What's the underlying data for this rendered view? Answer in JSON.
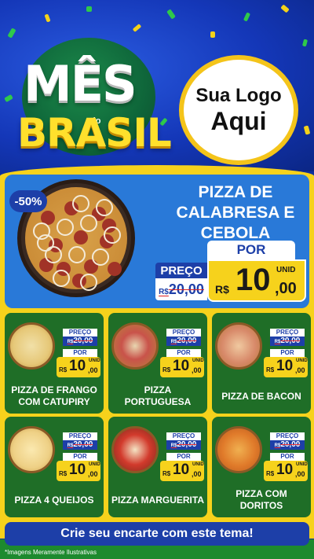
{
  "header": {
    "title_line1": "MÊS",
    "title_do": "do",
    "title_line2": "BRASIL",
    "logo_line1": "Sua Logo",
    "logo_line2": "Aqui"
  },
  "featured": {
    "discount": "-50%",
    "name": "PIZZA DE CALABRESA E CEBOLA",
    "preco_label": "PREÇO",
    "old_currency": "R$",
    "old_price": "20,00",
    "por_label": "POR",
    "currency": "R$",
    "price_int": "10",
    "price_cents": ",00",
    "unit": "UNID"
  },
  "products": [
    {
      "name": "PIZZA DE FRANGO COM CATUPIRY",
      "preco_label": "PREÇO",
      "old_currency": "R$",
      "old_price": "20,00",
      "por_label": "POR",
      "currency": "R$",
      "price_int": "10",
      "price_cents": ",00",
      "unit": "UNID"
    },
    {
      "name": "PIZZA PORTUGUESA",
      "preco_label": "PREÇO",
      "old_currency": "R$",
      "old_price": "20,00",
      "por_label": "POR",
      "currency": "R$",
      "price_int": "10",
      "price_cents": ",00",
      "unit": "UNID"
    },
    {
      "name": "PIZZA DE BACON",
      "preco_label": "PREÇO",
      "old_currency": "R$",
      "old_price": "20,00",
      "por_label": "POR",
      "currency": "R$",
      "price_int": "10",
      "price_cents": ",00",
      "unit": "UNID"
    },
    {
      "name": "PIZZA 4 QUEIJOS",
      "preco_label": "PREÇO",
      "old_currency": "R$",
      "old_price": "20,00",
      "por_label": "POR",
      "currency": "R$",
      "price_int": "10",
      "price_cents": ",00",
      "unit": "UNID"
    },
    {
      "name": "PIZZA MARGUERITA",
      "preco_label": "PREÇO",
      "old_currency": "R$",
      "old_price": "20,00",
      "por_label": "POR",
      "currency": "R$",
      "price_int": "10",
      "price_cents": ",00",
      "unit": "UNID"
    },
    {
      "name": "PIZZA COM DORITOS",
      "preco_label": "PREÇO",
      "old_currency": "R$",
      "old_price": "20,00",
      "por_label": "POR",
      "currency": "R$",
      "price_int": "10",
      "price_cents": ",00",
      "unit": "UNID"
    }
  ],
  "footer": {
    "cta": "Crie seu encarte com este tema!",
    "disclaimer": "*Imagens Meramente Ilustrativas"
  },
  "colors": {
    "header_blue": "#1437b8",
    "panel_yellow": "#f6d21c",
    "featured_blue": "#2979d8",
    "card_green": "#1f6e27",
    "accent_navy": "#1d3fa8",
    "strike_red": "#dd2222"
  }
}
